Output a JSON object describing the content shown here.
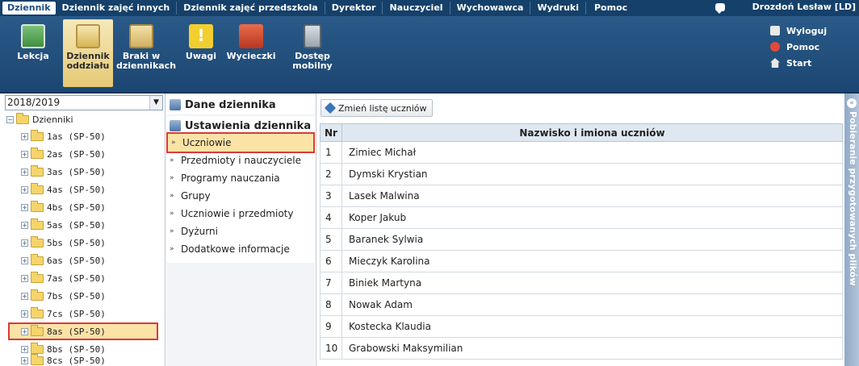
{
  "topmenu": {
    "items": [
      "Dziennik",
      "Dziennik zajęć innych",
      "Dziennik zajęć przedszkola",
      "Dyrektor",
      "Nauczyciel",
      "Wychowawca",
      "Wydruki",
      "Pomoc"
    ],
    "user": "Drozdoń Lesław [LD]"
  },
  "toolbar": {
    "buttons": [
      {
        "label1": "Lekcja",
        "label2": ""
      },
      {
        "label1": "Dziennik",
        "label2": "oddziału"
      },
      {
        "label1": "Braki w",
        "label2": "dziennikach"
      },
      {
        "label1": "Uwagi",
        "label2": ""
      },
      {
        "label1": "Wycieczki",
        "label2": ""
      },
      {
        "label1": "Dostęp",
        "label2": "mobilny"
      }
    ],
    "links": [
      "Wyloguj",
      "Pomoc",
      "Start"
    ]
  },
  "tree": {
    "year": "2018/2019",
    "root": "Dzienniki",
    "items": [
      "1as (SP-50)",
      "2as (SP-50)",
      "3as (SP-50)",
      "4as (SP-50)",
      "4bs (SP-50)",
      "5as (SP-50)",
      "5bs (SP-50)",
      "6as (SP-50)",
      "7as (SP-50)",
      "7bs (SP-50)",
      "7cs (SP-50)",
      "8as (SP-50)",
      "8bs (SP-50)",
      "8cs (SP-50)"
    ]
  },
  "menu": {
    "head1": "Dane dziennika",
    "head2": "Ustawienia dziennika",
    "items": [
      "Uczniowie",
      "Przedmioty i nauczyciele",
      "Programy nauczania",
      "Grupy",
      "Uczniowie i przedmioty",
      "Dyżurni",
      "Dodatkowe informacje"
    ]
  },
  "main": {
    "change_button": "Zmień listę uczniów",
    "col_nr": "Nr",
    "col_name": "Nazwisko i imiona uczniów",
    "rows": [
      {
        "nr": "1",
        "name": "Zimiec Michał"
      },
      {
        "nr": "2",
        "name": "Dymski Krystian"
      },
      {
        "nr": "3",
        "name": "Lasek Malwina"
      },
      {
        "nr": "4",
        "name": "Koper Jakub"
      },
      {
        "nr": "5",
        "name": "Baranek Sylwia"
      },
      {
        "nr": "6",
        "name": "Mieczyk Karolina"
      },
      {
        "nr": "7",
        "name": "Biniek Martyna"
      },
      {
        "nr": "8",
        "name": "Nowak Adam"
      },
      {
        "nr": "9",
        "name": "Kostecka Klaudia"
      },
      {
        "nr": "10",
        "name": "Grabowski Maksymilian"
      }
    ]
  },
  "rightpanel": {
    "label": "Pobieranie przygotowanych plików"
  }
}
